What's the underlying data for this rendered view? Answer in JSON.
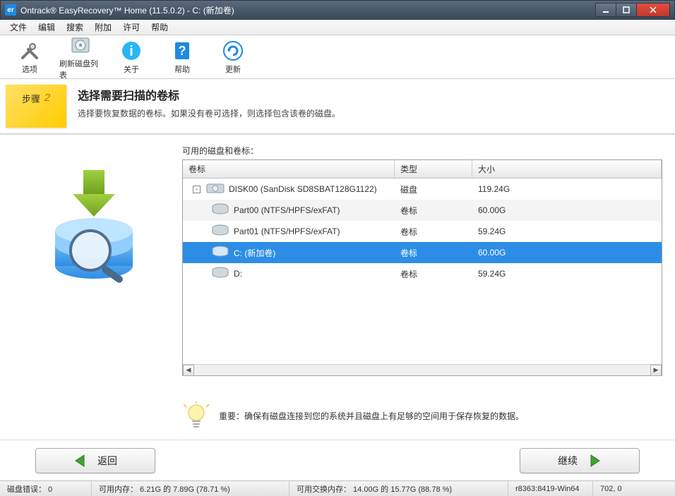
{
  "window": {
    "app_icon_text": "er",
    "title": "Ontrack® EasyRecovery™ Home (11.5.0.2) - C: (新加卷)"
  },
  "menu": {
    "items": [
      "文件",
      "编辑",
      "搜索",
      "附加",
      "许可",
      "帮助"
    ]
  },
  "toolbar": {
    "items": [
      {
        "label": "选项"
      },
      {
        "label": "刷新磁盘列表"
      },
      {
        "label": "关于"
      },
      {
        "label": "帮助"
      },
      {
        "label": "更新"
      }
    ]
  },
  "step": {
    "word": "步骤",
    "number": "2",
    "title": "选择需要扫描的卷标",
    "subtitle": "选择要恢复数据的卷标。如果没有卷可选择，则选择包含该卷的磁盘。"
  },
  "disks": {
    "panel_label": "可用的磁盘和卷标：",
    "columns": {
      "volume": "卷标",
      "type": "类型",
      "size": "大小"
    },
    "rows": [
      {
        "indent": 0,
        "toggle": "-",
        "icon": "disk",
        "label": "DISK00 (SanDisk SD8SBAT128G1122)",
        "type": "磁盘",
        "size": "119.24G",
        "selected": false
      },
      {
        "indent": 1,
        "icon": "vol",
        "label": "Part00 (NTFS/HPFS/exFAT)",
        "type": "卷标",
        "size": "60.00G",
        "selected": false,
        "alt": true
      },
      {
        "indent": 1,
        "icon": "vol",
        "label": "Part01 (NTFS/HPFS/exFAT)",
        "type": "卷标",
        "size": "59.24G",
        "selected": false
      },
      {
        "indent": 1,
        "icon": "vol",
        "label": "C: (新加卷)",
        "type": "卷标",
        "size": "60.00G",
        "selected": true
      },
      {
        "indent": 1,
        "icon": "vol",
        "label": "D:",
        "type": "卷标",
        "size": "59.24G",
        "selected": false
      }
    ]
  },
  "hint": {
    "label": "重要：",
    "text": "确保有磁盘连接到您的系统并且磁盘上有足够的空间用于保存恢复的数据。"
  },
  "nav": {
    "back": "返回",
    "continue": "继续"
  },
  "status": {
    "disk_errors": "磁盘错误： 0",
    "mem": "可用内存： 6.21G 的 7.89G (78.71 %)",
    "swap": "可用交换内存： 14.00G 的 15.77G (88.78 %)",
    "build": "r8363:8419-Win64",
    "coords": "702, 0"
  }
}
